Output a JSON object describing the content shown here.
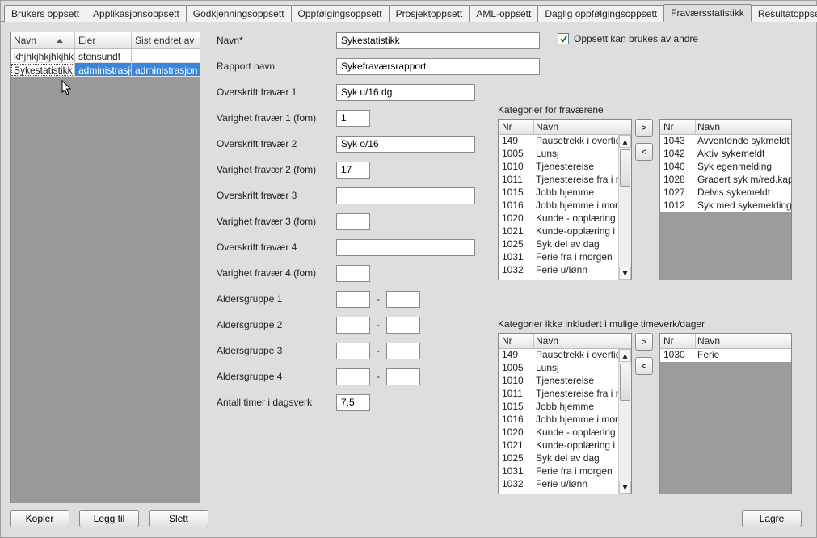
{
  "tabs": [
    "Brukers oppsett",
    "Applikasjonsoppsett",
    "Godkjenningsoppsett",
    "Oppfølgingsoppsett",
    "Prosjektoppsett",
    "AML-oppsett",
    "Daglig oppfølgingsoppsett",
    "Fraværsstatistikk",
    "Resultatoppsett"
  ],
  "active_tab": 7,
  "left_list": {
    "columns": [
      "Navn",
      "Eier",
      "Sist endret av"
    ],
    "rows": [
      {
        "navn": "khjhkjhkjhkjhkj",
        "eier": "stensundt",
        "sist": ""
      },
      {
        "navn": "Sykestatistikk",
        "eier": "administrasjo",
        "sist": "administrasjon"
      }
    ],
    "selected_index": 1
  },
  "buttons": {
    "kopier": "Kopier",
    "leggtil": "Legg til",
    "slett": "Slett",
    "lagre": "Lagre"
  },
  "checkbox_label": "Oppsett kan brukes av andre",
  "form": {
    "labels": {
      "navn": "Navn*",
      "rapport_navn": "Rapport navn",
      "ov1": "Overskrift fravær 1",
      "var1": "Varighet fravær 1 (fom)",
      "ov2": "Overskrift fravær 2",
      "var2": "Varighet fravær 2 (fom)",
      "ov3": "Overskrift fravær 3",
      "var3": "Varighet fravær 3 (fom)",
      "ov4": "Overskrift fravær 4",
      "var4": "Varighet fravær 4 (fom)",
      "ag1": "Aldersgruppe 1",
      "ag2": "Aldersgruppe 2",
      "ag3": "Aldersgruppe 3",
      "ag4": "Aldersgruppe 4",
      "antall": "Antall timer i dagsverk"
    },
    "navn": "Sykestatistikk",
    "rapport_navn": "Sykefraværsrapport",
    "ov1": "Syk u/16 dg",
    "var1": "1",
    "ov2": "Syk o/16",
    "var2": "17",
    "ov3": "",
    "var3": "",
    "ov4": "",
    "var4": "",
    "ag1a": "",
    "ag1b": "",
    "ag2a": "",
    "ag2b": "",
    "ag3a": "",
    "ag3b": "",
    "ag4a": "",
    "ag4b": "",
    "antall": "7,5"
  },
  "category_section_titles": {
    "top": "Kategorier for fraværene",
    "bot": "Kategorier ikke inkludert i mulige timeverk/dager"
  },
  "cat_headers": {
    "nr": "Nr",
    "navn": "Navn"
  },
  "available_categories": [
    {
      "nr": "149",
      "navn": "Pausetrekk i overtid"
    },
    {
      "nr": "1005",
      "navn": "Lunsj"
    },
    {
      "nr": "1010",
      "navn": "Tjenestereise"
    },
    {
      "nr": "1011",
      "navn": "Tjenestereise fra i m"
    },
    {
      "nr": "1015",
      "navn": "Jobb hjemme"
    },
    {
      "nr": "1016",
      "navn": "Jobb hjemme i morg"
    },
    {
      "nr": "1020",
      "navn": "Kunde - opplæring"
    },
    {
      "nr": "1021",
      "navn": "Kunde-opplæring i n"
    },
    {
      "nr": "1025",
      "navn": "Syk del av dag"
    },
    {
      "nr": "1031",
      "navn": "Ferie fra i morgen"
    },
    {
      "nr": "1032",
      "navn": "Ferie u/lønn"
    }
  ],
  "selected_categories_top": [
    {
      "nr": "1043",
      "navn": "Avventende sykmeldt"
    },
    {
      "nr": "1042",
      "navn": "Aktiv sykemeldt"
    },
    {
      "nr": "1040",
      "navn": "Syk egenmelding"
    },
    {
      "nr": "1028",
      "navn": "Gradert syk m/red.kapa"
    },
    {
      "nr": "1027",
      "navn": "Delvis sykemeldt"
    },
    {
      "nr": "1012",
      "navn": "Syk med sykemelding"
    }
  ],
  "selected_categories_bot": [
    {
      "nr": "1030",
      "navn": "Ferie"
    }
  ],
  "transfer": {
    "right": ">",
    "left": "<"
  }
}
